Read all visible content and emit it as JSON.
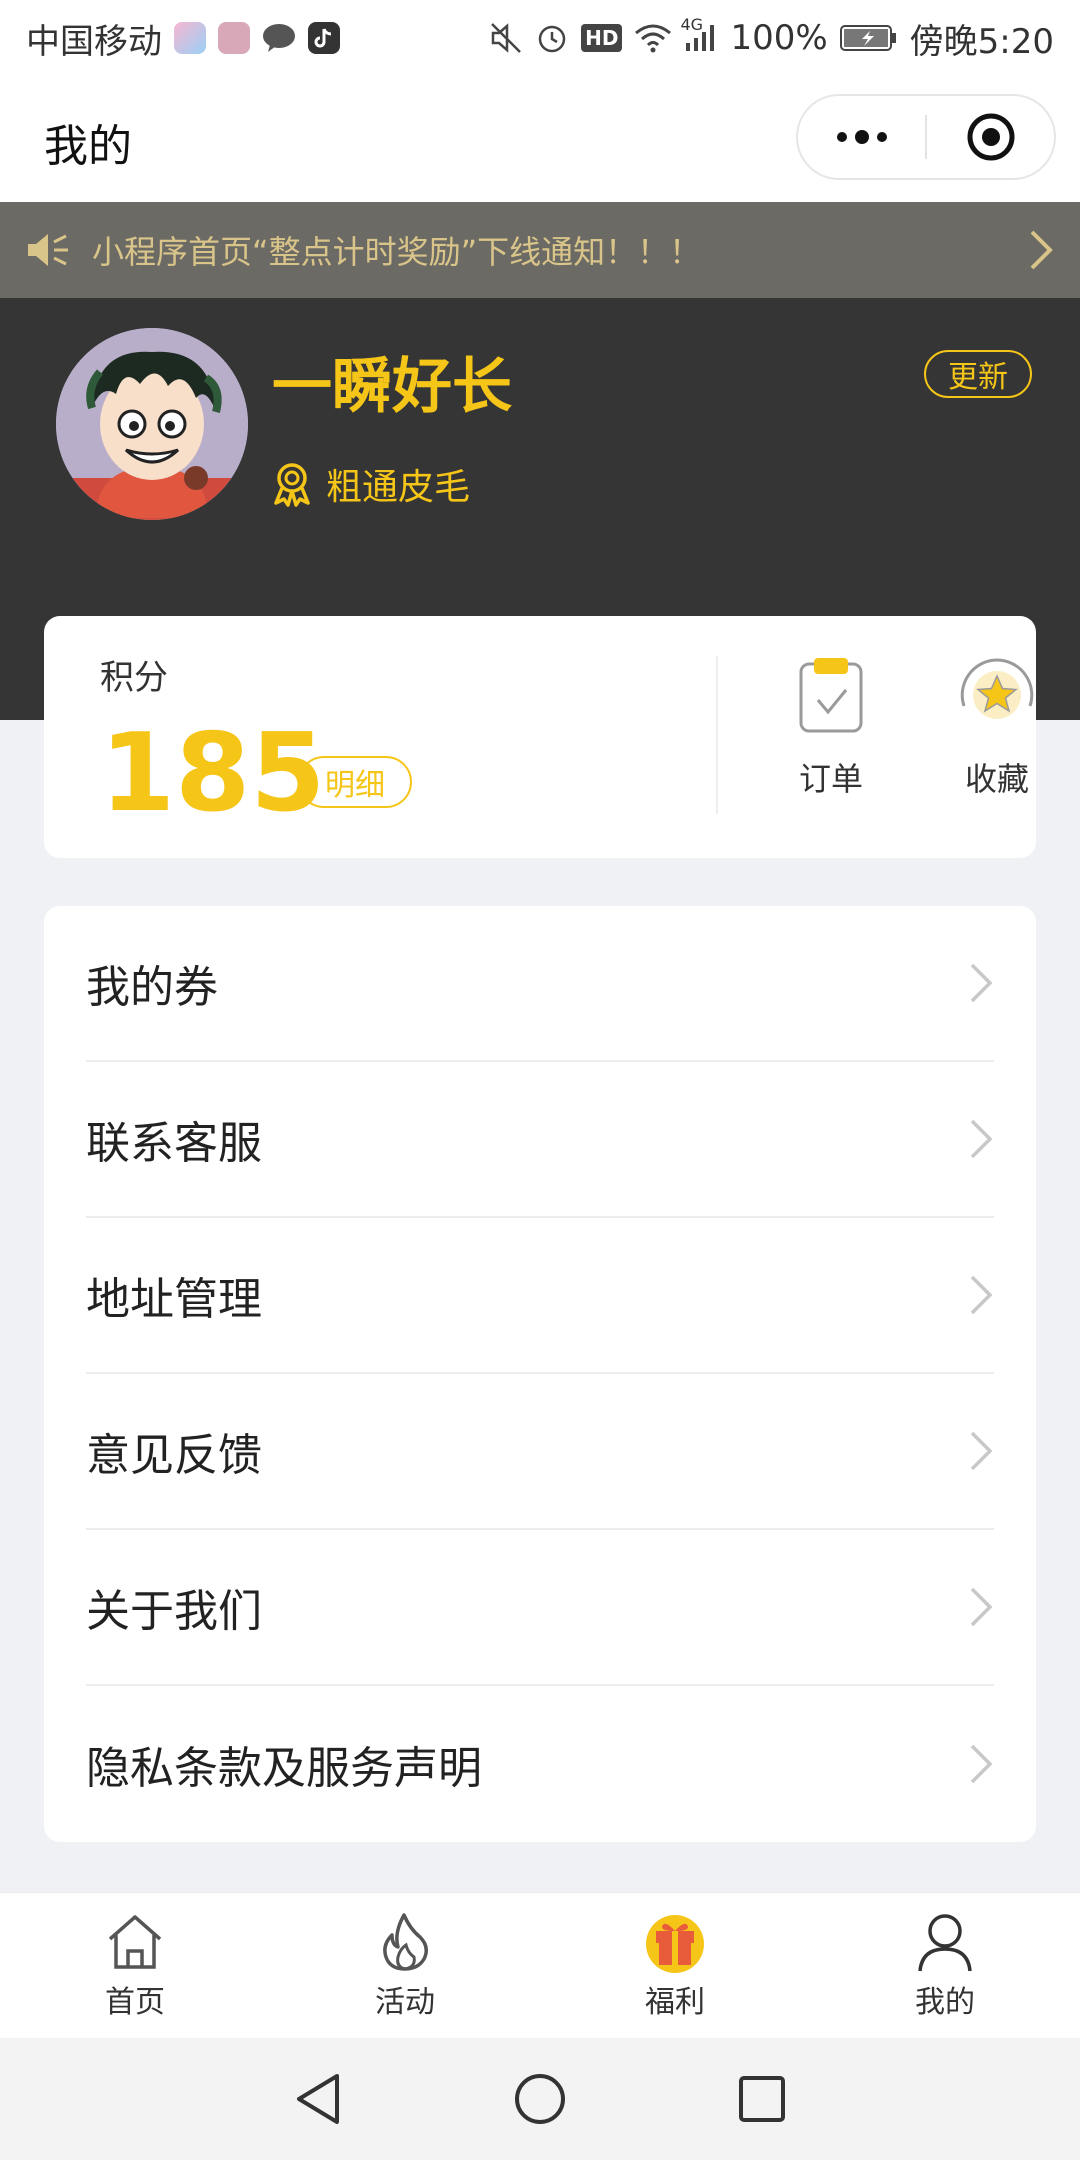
{
  "status_bar": {
    "carrier": "中国移动",
    "battery": "100%",
    "network": "4G",
    "hd": "HD",
    "time": "傍晚5:20"
  },
  "title_bar": {
    "title": "我的"
  },
  "notice": {
    "text": "小程序首页“整点计时奖励”下线通知！！！"
  },
  "profile": {
    "name": "一瞬好长",
    "level": "粗通皮毛",
    "update_label": "更新"
  },
  "points": {
    "label": "积分",
    "value": "185",
    "detail_label": "明细"
  },
  "quick_actions": [
    {
      "label": "订单",
      "icon": "clipboard-check-icon"
    },
    {
      "label": "收藏",
      "icon": "star-icon"
    }
  ],
  "menu": {
    "items": [
      {
        "label": "我的券"
      },
      {
        "label": "联系客服"
      },
      {
        "label": "地址管理"
      },
      {
        "label": "意见反馈"
      },
      {
        "label": "关于我们"
      },
      {
        "label": "隐私条款及服务声明"
      }
    ]
  },
  "tabbar": {
    "tabs": [
      {
        "label": "首页",
        "icon": "home-icon"
      },
      {
        "label": "活动",
        "icon": "flame-icon"
      },
      {
        "label": "福利",
        "icon": "gift-icon"
      },
      {
        "label": "我的",
        "icon": "user-icon"
      }
    ]
  },
  "colors": {
    "accent": "#f5c518",
    "header_bg": "#353535",
    "notice_bg": "#6b6a64",
    "notice_text": "#d9c48a",
    "page_bg": "#eff1f4"
  }
}
